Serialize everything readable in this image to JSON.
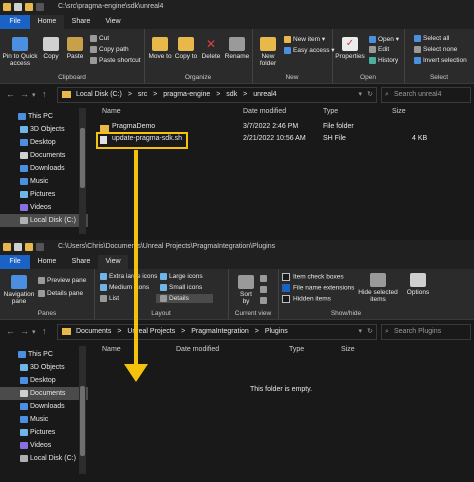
{
  "top_window": {
    "title_path": "C:\\src\\pragma-engine\\sdk\\unreal4",
    "tabs": [
      "File",
      "Home",
      "Share",
      "View"
    ],
    "clipboard": {
      "pin": "Pin to Quick access",
      "copy": "Copy",
      "paste": "Paste",
      "cut": "Cut",
      "copy_path": "Copy path",
      "paste_shortcut": "Paste shortcut",
      "label": "Clipboard"
    },
    "organize": {
      "move_to": "Move to",
      "copy_to": "Copy to",
      "delete": "Delete",
      "rename": "Rename",
      "label": "Organize"
    },
    "new": {
      "new_item": "New item",
      "easy_access": "Easy access",
      "new_folder": "New folder",
      "label": "New"
    },
    "open": {
      "properties": "Properties",
      "open": "Open",
      "edit": "Edit",
      "history": "History",
      "label": "Open"
    },
    "select": {
      "select_all": "Select all",
      "select_none": "Select none",
      "invert": "Invert selection",
      "label": "Select"
    },
    "breadcrumb": [
      "Local Disk (C:)",
      ">",
      "src",
      ">",
      "pragma-engine",
      ">",
      "sdk",
      ">",
      "unreal4"
    ],
    "search_placeholder": "Search unreal4",
    "columns": [
      "Name",
      "Date modified",
      "Type",
      "Size"
    ],
    "files": [
      {
        "name": "PragmaDemo",
        "date": "3/7/2022 2:46 PM",
        "type": "File folder",
        "size": ""
      },
      {
        "name": "update-pragma-sdk.sh",
        "date": "2/21/2022 10:56 AM",
        "type": "SH File",
        "size": "4 KB"
      }
    ],
    "sidebar": [
      "This PC",
      "3D Objects",
      "Desktop",
      "Documents",
      "Downloads",
      "Music",
      "Pictures",
      "Videos",
      "Local Disk (C:)"
    ]
  },
  "bottom_window": {
    "title_path": "C:\\Users\\Chris\\Documents\\Unreal Projects\\PragmaIntegration\\Plugins",
    "tabs": [
      "File",
      "Home",
      "Share",
      "View"
    ],
    "panes": {
      "nav_pane": "Navigation pane",
      "preview": "Preview pane",
      "details": "Details pane",
      "label": "Panes"
    },
    "layout": {
      "extra_large": "Extra large icons",
      "large": "Large icons",
      "medium": "Medium icons",
      "small": "Small icons",
      "list": "List",
      "details": "Details",
      "label": "Layout"
    },
    "current_view": {
      "sort_by": "Sort by",
      "label": "Current view"
    },
    "show_hide": {
      "item_check": "Item check boxes",
      "file_ext": "File name extensions",
      "hidden": "Hidden items",
      "hide_selected": "Hide selected items",
      "options": "Options",
      "label": "Show/hide"
    },
    "breadcrumb": [
      "Documents",
      ">",
      "Unreal Projects",
      ">",
      "PragmaIntegration",
      ">",
      "Plugins"
    ],
    "search_placeholder": "Search Plugins",
    "columns": [
      "Name",
      "Date modified",
      "Type",
      "Size"
    ],
    "empty_text": "This folder is empty.",
    "sidebar": [
      "This PC",
      "3D Objects",
      "Desktop",
      "Documents",
      "Downloads",
      "Music",
      "Pictures",
      "Videos",
      "Local Disk (C:)"
    ]
  },
  "colors": {
    "accent": "#1a62c5",
    "highlight": "#f4c20d",
    "folder": "#e8b84a"
  }
}
